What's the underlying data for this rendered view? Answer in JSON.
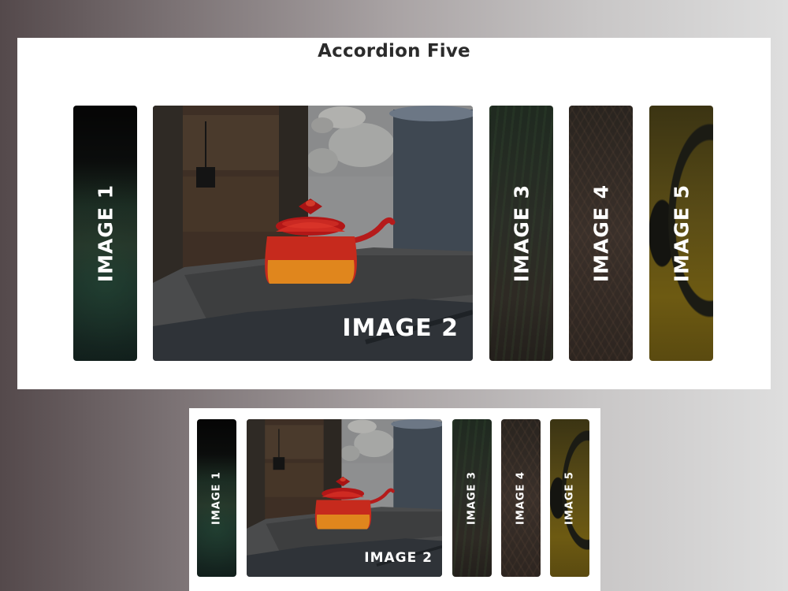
{
  "accordion": {
    "title": "Accordion Five",
    "panels": [
      {
        "label": "IMAGE 1",
        "state": "collapsed"
      },
      {
        "label": "IMAGE 2",
        "state": "expanded"
      },
      {
        "label": "IMAGE 3",
        "state": "collapsed"
      },
      {
        "label": "IMAGE 4",
        "state": "collapsed"
      },
      {
        "label": "IMAGE 5",
        "state": "collapsed"
      }
    ]
  },
  "colors": {
    "card_background": "#ffffff",
    "title_color": "#2b2b2b",
    "label_color": "#ffffff",
    "kettle_red": "#c81e1e",
    "kettle_orange": "#e58a1e"
  },
  "icons": {
    "panel_2_scene": "red-kettle-photo",
    "panel_5_scene": "headphones-photo"
  }
}
